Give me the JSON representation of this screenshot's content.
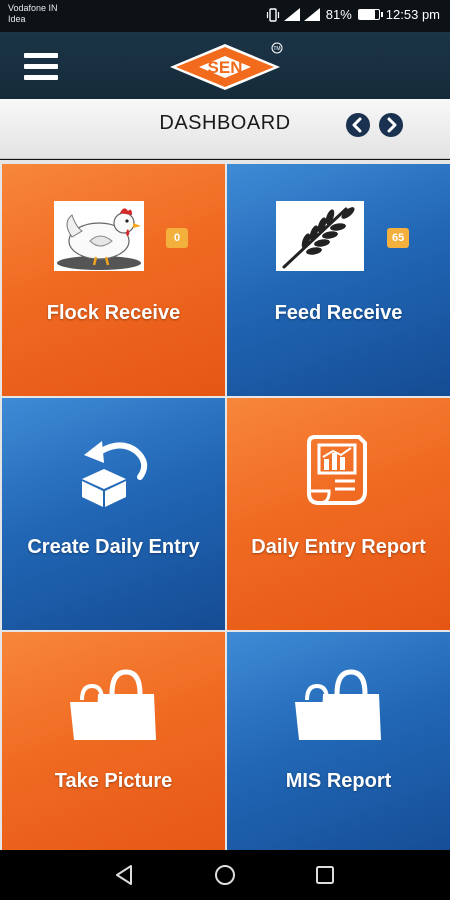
{
  "status_bar": {
    "carrier_line1": "Vodafone IN",
    "carrier_line2": "Idea",
    "battery_percent": "81%",
    "battery_level": 0.81,
    "time": "12:53 pm",
    "icons": [
      "vibrate-icon",
      "signal-icon",
      "signal-icon",
      "battery-icon"
    ]
  },
  "app_bar": {
    "logo_text": "SEN",
    "logo_mark": "TM",
    "menu_icon": "hamburger-menu-icon",
    "colors": {
      "app_bar": "#1b3446",
      "logo_orange": "#f26a1b"
    }
  },
  "title_bar": {
    "title": "DASHBOARD",
    "prev_icon": "chevron-left-icon",
    "next_icon": "chevron-right-icon"
  },
  "tiles": [
    {
      "label": "Flock Receive",
      "badge": "0",
      "icon": "chicken-image",
      "color": "orange"
    },
    {
      "label": "Feed Receive",
      "badge": "65",
      "icon": "wheat-image",
      "color": "blue"
    },
    {
      "label": "Create Daily Entry",
      "icon": "box-undo-icon",
      "color": "blue"
    },
    {
      "label": "Daily Entry Report",
      "icon": "report-chart-icon",
      "color": "orange"
    },
    {
      "label": "Take Picture",
      "icon": "shopping-bags-icon",
      "color": "orange"
    },
    {
      "label": "MIS Report",
      "icon": "shopping-bags-icon",
      "color": "blue"
    }
  ],
  "nav_bar": {
    "buttons": [
      "back-icon",
      "home-icon",
      "recents-icon"
    ]
  },
  "colors": {
    "orange": "#f06a22",
    "blue": "#2167b6",
    "badge": "#f3b03d"
  }
}
